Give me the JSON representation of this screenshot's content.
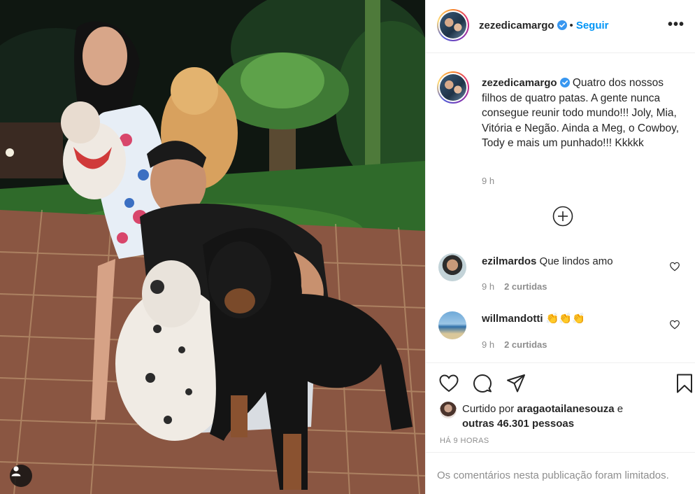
{
  "post": {
    "username": "zezedicamargo",
    "separator": "•",
    "follow_label": "Seguir",
    "more_label": "•••"
  },
  "caption": {
    "username": "zezedicamargo",
    "text": "Quatro dos nossos filhos de quatro patas. A gente nunca consegue reunir todo mundo!!! Joly, Mia, Vitória e Negão. Ainda a Meg, o Cowboy, Tody e mais um punhado!!! Kkkkk",
    "time": "9 h"
  },
  "comments": [
    {
      "username": "ezilmardos",
      "text": "Que lindos amo",
      "time": "9 h",
      "likes": "2 curtidas"
    },
    {
      "username": "willmandotti",
      "text": "👏👏👏",
      "time": "9 h",
      "likes": "2 curtidas"
    }
  ],
  "likes": {
    "prefix": "Curtido por",
    "user": "aragaotailanesouza",
    "conj": "e",
    "others": "outras 46.301 pessoas"
  },
  "time_ago": "HÁ 9 HORAS",
  "comments_limited": "Os comentários nesta publicação foram limitados.",
  "colors": {
    "accent": "#0095f6",
    "text": "#262626",
    "muted": "#8e8e8e",
    "border": "#efefef"
  },
  "icons": [
    "verified-badge-icon",
    "more-options-icon",
    "load-more-comments-icon",
    "heart-icon",
    "comment-icon",
    "share-icon",
    "bookmark-icon",
    "user-tag-icon"
  ]
}
